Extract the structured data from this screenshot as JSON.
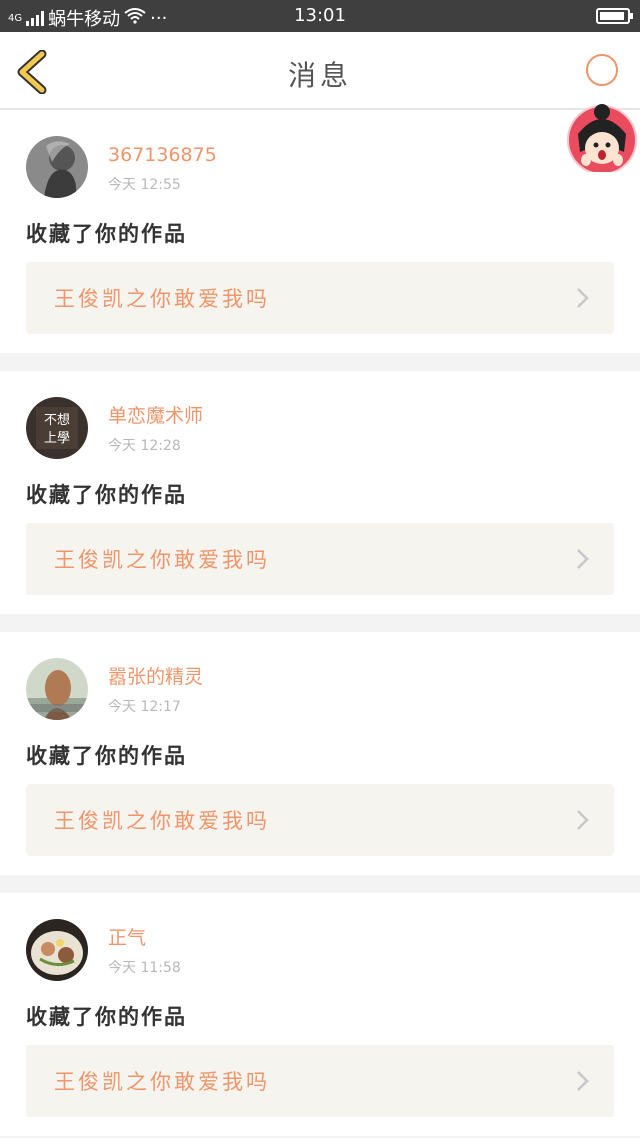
{
  "status_bar": {
    "network": "4G",
    "carrier": "蜗牛移动",
    "dots": "···",
    "time": "13:01"
  },
  "nav": {
    "title": "消息"
  },
  "messages": [
    {
      "user": "367136875",
      "time": "今天 12:55",
      "action": "收藏了你的作品",
      "work": "王俊凯之你敢爱我吗"
    },
    {
      "user": "单恋魔术师",
      "time": "今天 12:28",
      "action": "收藏了你的作品",
      "work": "王俊凯之你敢爱我吗",
      "avatar_text": "不想 上學"
    },
    {
      "user": "嚣张的精灵",
      "time": "今天 12:17",
      "action": "收藏了你的作品",
      "work": "王俊凯之你敢爱我吗"
    },
    {
      "user": "正气",
      "time": "今天 11:58",
      "action": "收藏了你的作品",
      "work": "王俊凯之你敢爱我吗"
    }
  ],
  "colors": {
    "accent": "#f0956a",
    "back_arrow": "#f2c94c",
    "status_bar_bg": "#3f3f3f"
  }
}
